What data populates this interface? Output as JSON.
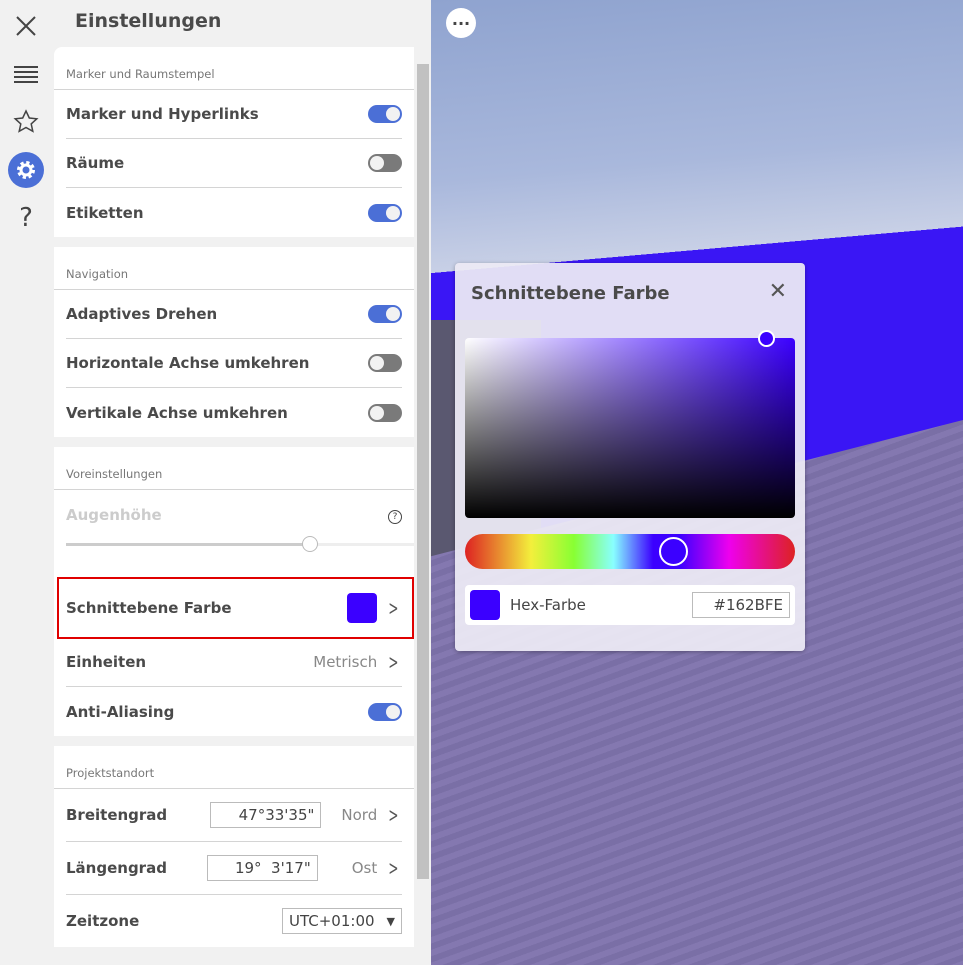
{
  "title": "Einstellungen",
  "rail": {
    "icons": [
      "close-icon",
      "list-icon",
      "star-icon",
      "gear-icon",
      "help-icon"
    ]
  },
  "sections": {
    "markers": {
      "header": "Marker und Raumstempel",
      "rows": [
        {
          "label": "Marker und Hyperlinks",
          "on": true
        },
        {
          "label": "Räume",
          "on": false
        },
        {
          "label": "Etiketten",
          "on": true
        }
      ]
    },
    "navigation": {
      "header": "Navigation",
      "rows": [
        {
          "label": "Adaptives Drehen",
          "on": true
        },
        {
          "label": "Horizontale Achse umkehren",
          "on": false
        },
        {
          "label": "Vertikale Achse umkehren",
          "on": false
        }
      ]
    },
    "presets": {
      "header": "Voreinstellungen",
      "eye_height": {
        "label": "Augenhöhe",
        "slider_value_percent": 70
      },
      "section_color": {
        "label": "Schnittebene Farbe",
        "color": "#3b00ff"
      },
      "units": {
        "label": "Einheiten",
        "value": "Metrisch"
      },
      "antialiasing": {
        "label": "Anti-Aliasing",
        "on": true
      }
    },
    "location": {
      "header": "Projektstandort",
      "latitude": {
        "label": "Breitengrad",
        "value": "47°33'35\"",
        "hemisphere": "Nord"
      },
      "longitude": {
        "label": "Längengrad",
        "value": "19°  3'17\"",
        "hemisphere": "Ost"
      },
      "timezone": {
        "label": "Zeitzone",
        "value": "UTC+01:00"
      }
    }
  },
  "popup": {
    "title": "Schnittebene Farbe",
    "hex_label": "Hex-Farbe",
    "hex_value": "#162BFE"
  },
  "viewport": {
    "menu_label": "···"
  }
}
